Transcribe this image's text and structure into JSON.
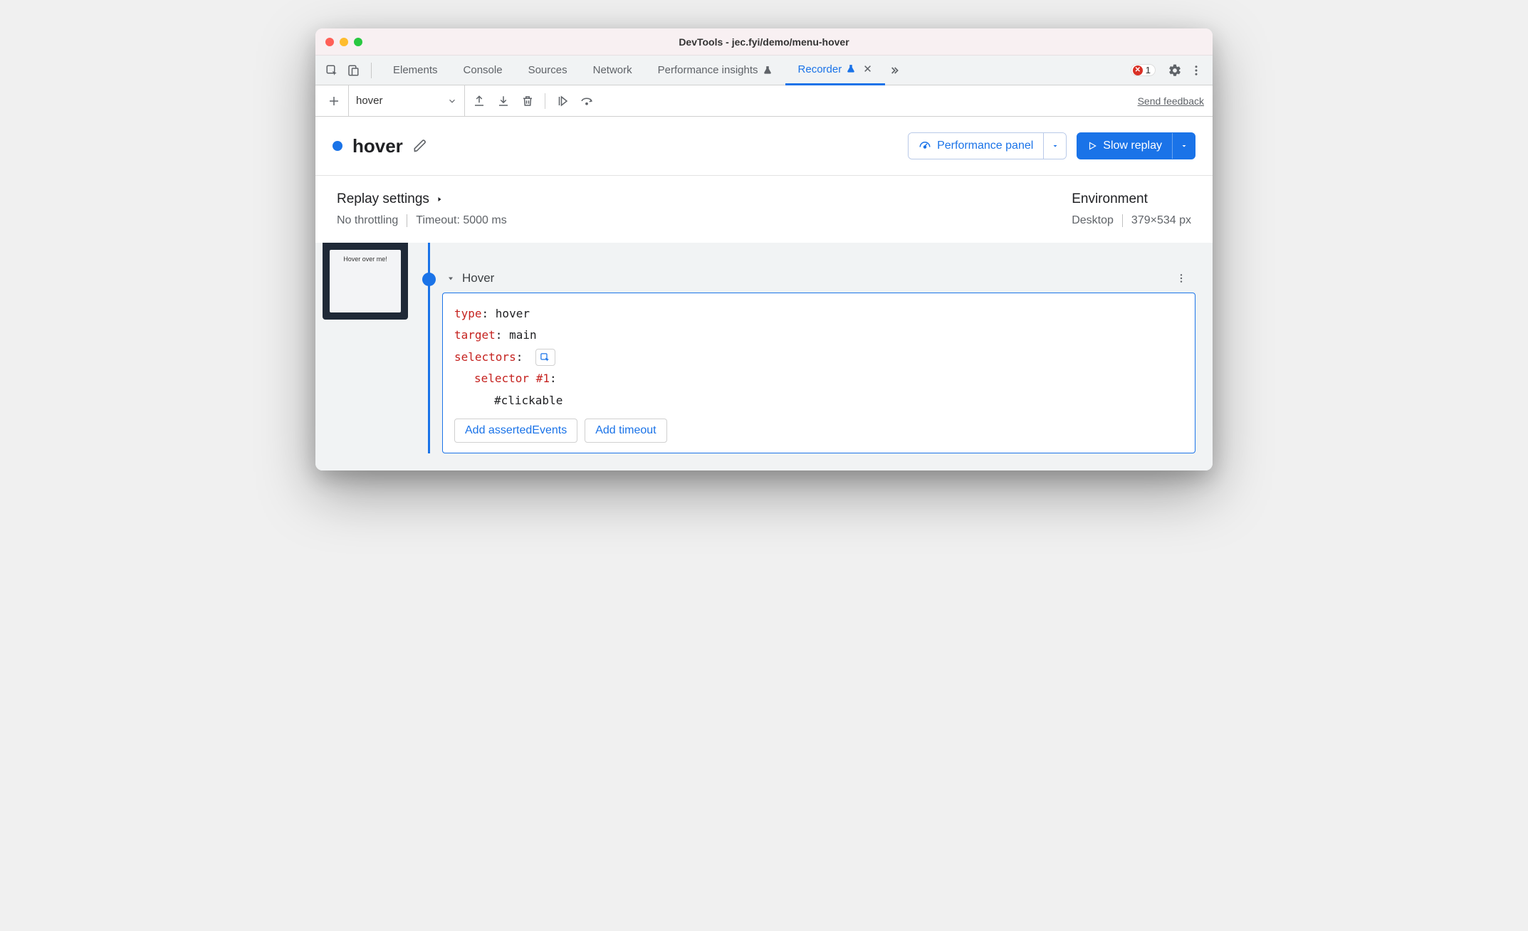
{
  "window": {
    "title": "DevTools - jec.fyi/demo/menu-hover"
  },
  "tabs": {
    "items": [
      {
        "label": "Elements"
      },
      {
        "label": "Console"
      },
      {
        "label": "Sources"
      },
      {
        "label": "Network"
      },
      {
        "label": "Performance insights"
      },
      {
        "label": "Recorder"
      }
    ],
    "error_count": "1"
  },
  "toolbar": {
    "recording_select": "hover",
    "feedback": "Send feedback"
  },
  "recording": {
    "title": "hover",
    "perf_button": "Performance panel",
    "replay_button": "Slow replay"
  },
  "settings": {
    "replay_label": "Replay settings",
    "throttling": "No throttling",
    "timeout": "Timeout: 5000 ms",
    "env_label": "Environment",
    "device": "Desktop",
    "viewport": "379×534 px"
  },
  "thumbnail": {
    "text": "Hover over me!"
  },
  "step": {
    "title": "Hover",
    "fields": {
      "type_key": "type",
      "type_val": "hover",
      "target_key": "target",
      "target_val": "main",
      "selectors_key": "selectors",
      "sel1_key": "selector #1",
      "sel1_val": "#clickable"
    },
    "add_asserted": "Add assertedEvents",
    "add_timeout": "Add timeout"
  }
}
